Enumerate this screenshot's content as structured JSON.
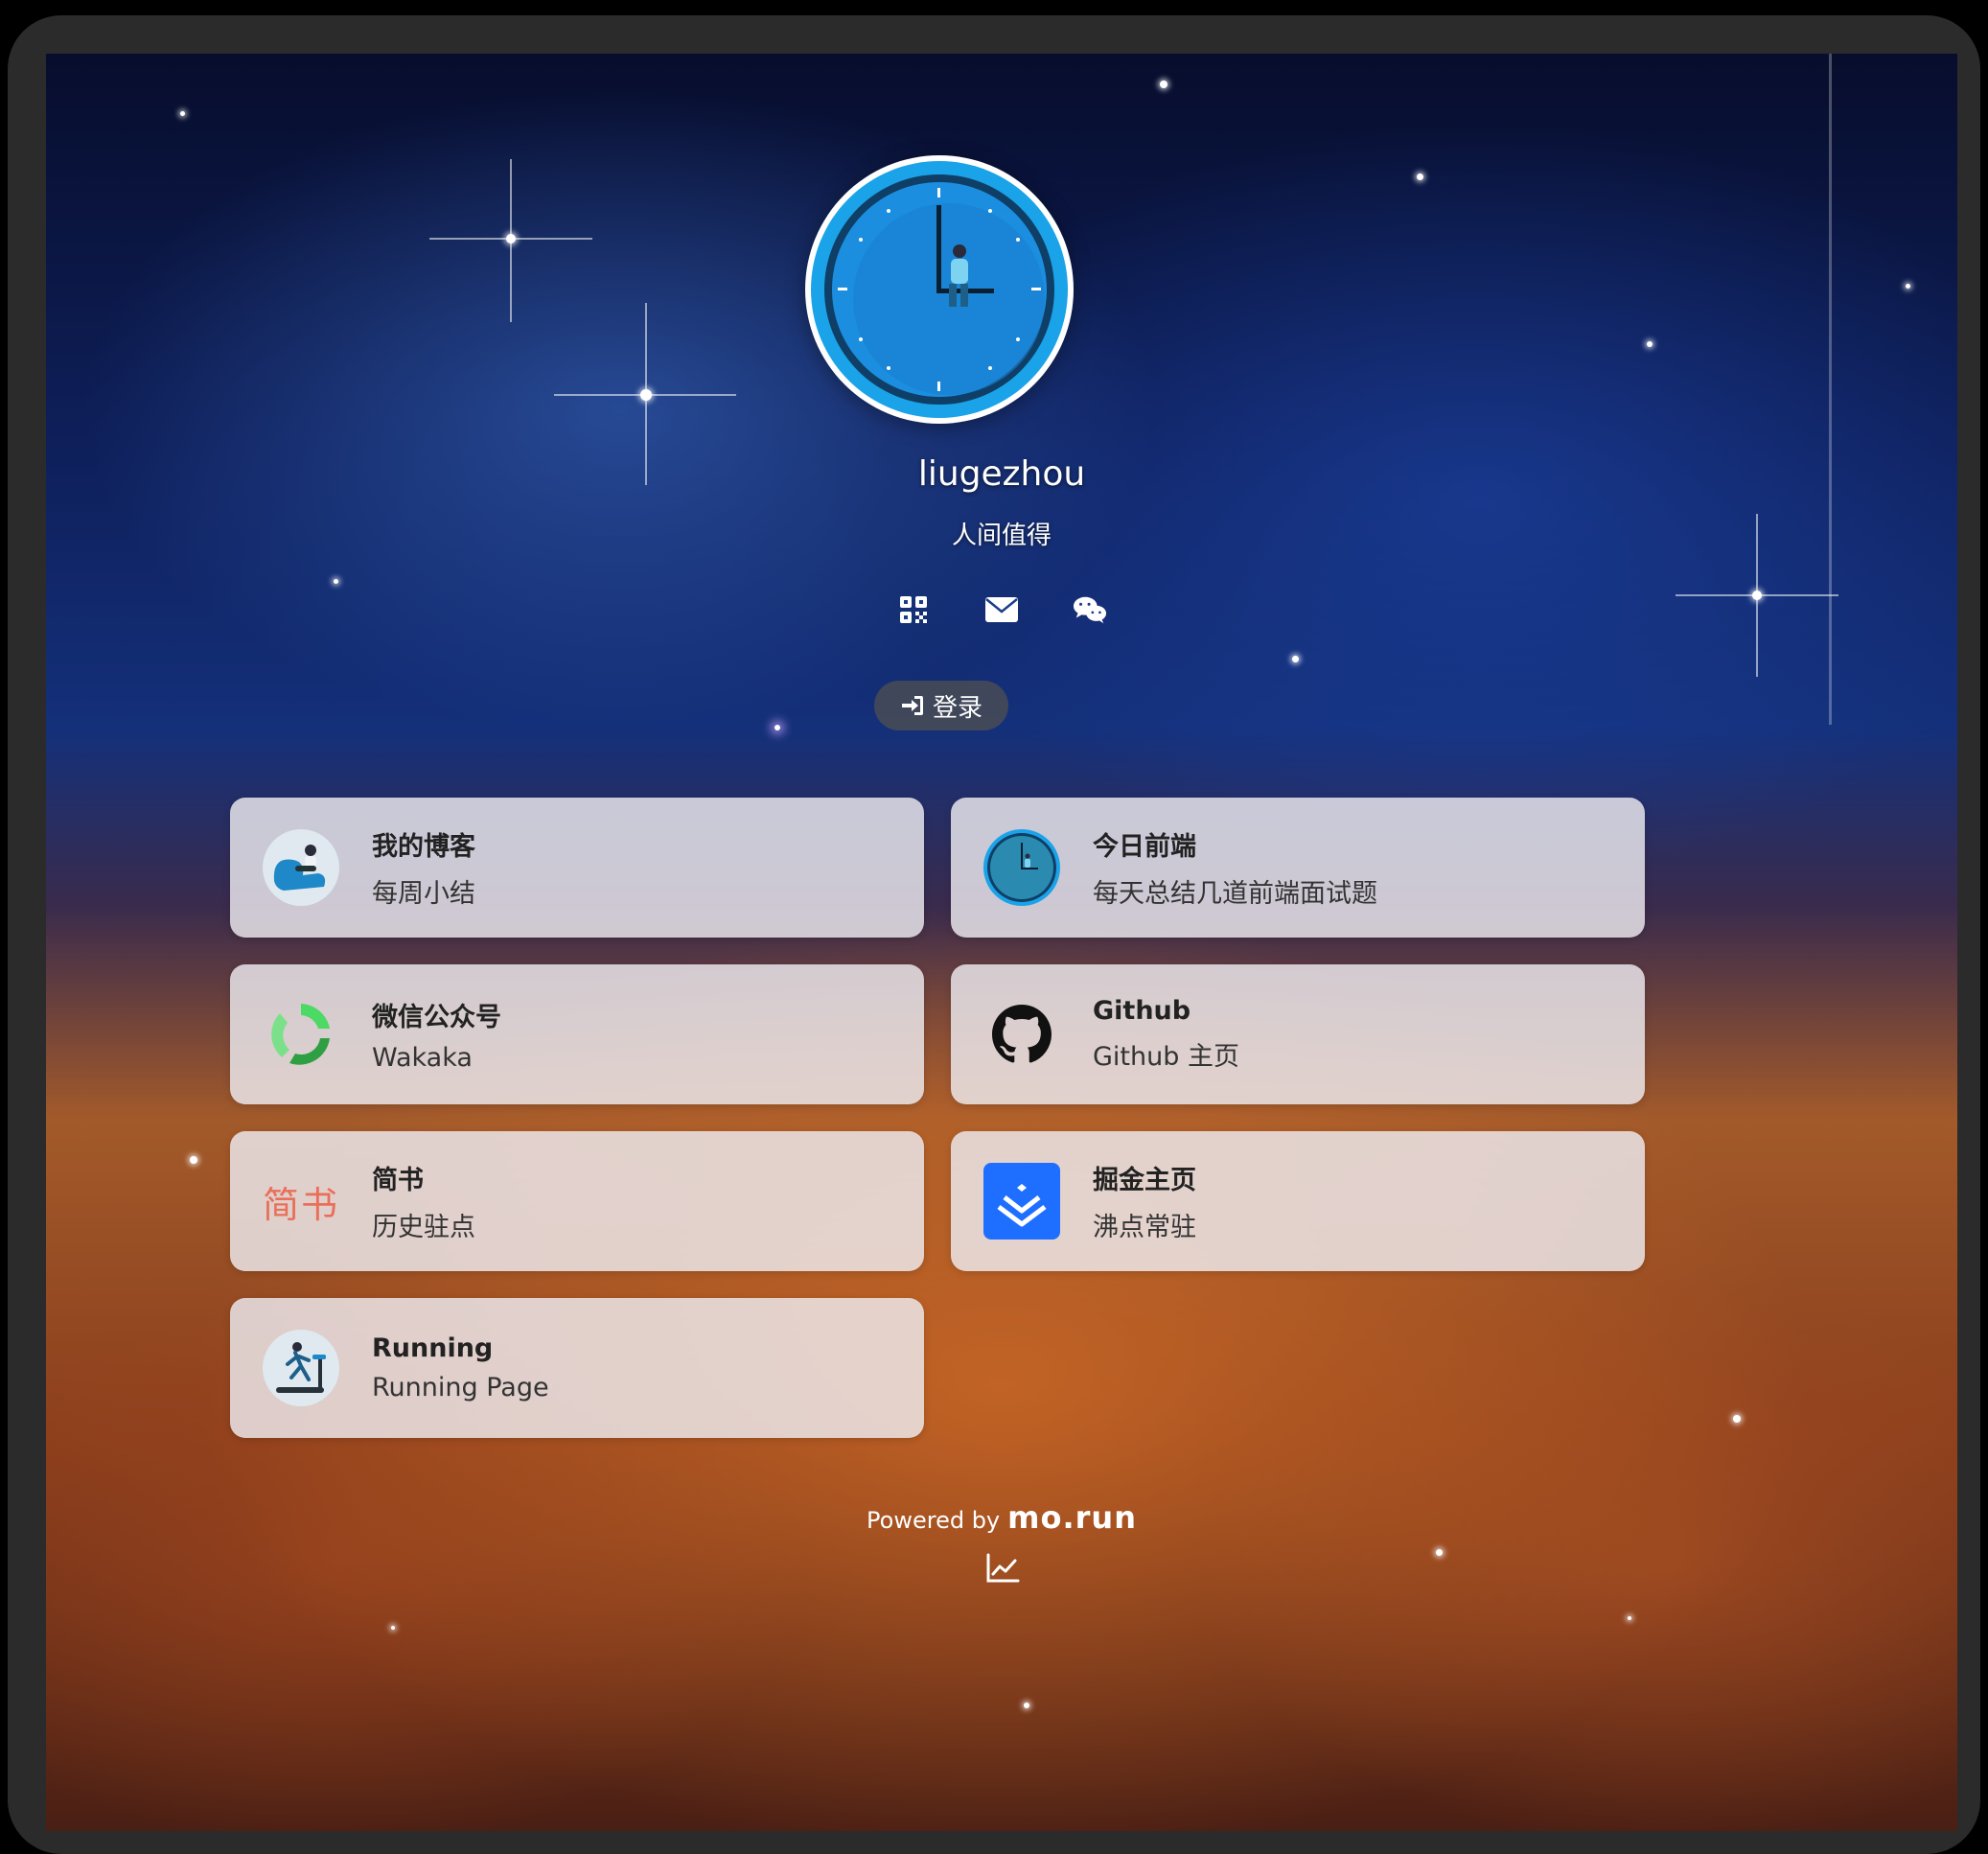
{
  "profile": {
    "username": "liugezhou",
    "bio": "人间值得"
  },
  "socials": [
    {
      "icon": "qrcode-icon"
    },
    {
      "icon": "mail-icon"
    },
    {
      "icon": "wechat-icon"
    }
  ],
  "login": {
    "label": "登录",
    "icon": "sign-in-icon"
  },
  "links": [
    {
      "title": "我的博客",
      "desc": "每周小结",
      "icon": "blog-avatar-icon"
    },
    {
      "title": "今日前端",
      "desc": "每天总结几道前端面试题",
      "icon": "clock-avatar-icon"
    },
    {
      "title": "微信公众号",
      "desc": "Wakaka",
      "icon": "wechat-official-icon"
    },
    {
      "title": "Github",
      "desc": "Github 主页",
      "icon": "github-icon"
    },
    {
      "title": "简书",
      "desc": "历史驻点",
      "icon": "jianshu-logo-icon",
      "logo_text": "简书"
    },
    {
      "title": "掘金主页",
      "desc": "沸点常驻",
      "icon": "juejin-icon"
    },
    {
      "title": "Running",
      "desc": "Running Page",
      "icon": "running-icon"
    }
  ],
  "footer": {
    "powered_by": "Powered by",
    "brand": "mo.run"
  },
  "colors": {
    "accent_blue": "#1da1f2",
    "juejin_blue": "#1e6fff",
    "jianshu_red": "#ea6f5a",
    "card_bg": "#eeecf0"
  }
}
